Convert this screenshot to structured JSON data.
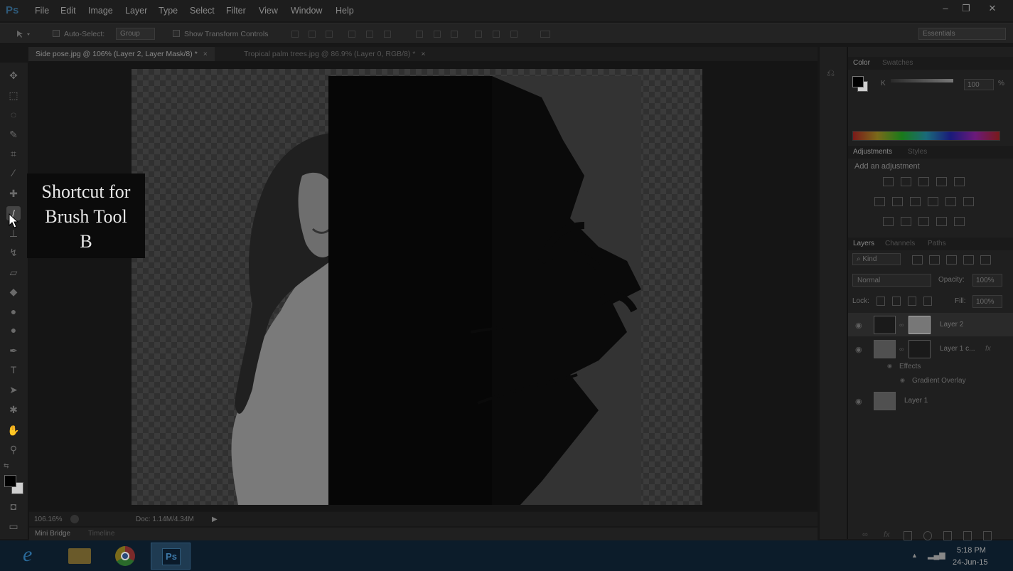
{
  "app": {
    "logo": "Ps",
    "menu": [
      "File",
      "Edit",
      "Image",
      "Layer",
      "Type",
      "Select",
      "Filter",
      "View",
      "Window",
      "Help"
    ],
    "window_controls": [
      "–",
      "❐",
      "✕"
    ]
  },
  "options_bar": {
    "auto_select_label": "Auto-Select:",
    "auto_select_value": "Group",
    "transform_label": "Show Transform Controls",
    "workspace": "Essentials"
  },
  "tabs": [
    {
      "label": "Side pose.jpg @ 106% (Layer 2, Layer Mask/8) *",
      "active": true
    },
    {
      "label": "Tropical palm trees.jpg @ 86.9% (Layer 0, RGB/8) *",
      "active": false
    }
  ],
  "tooltip": {
    "line1": "Shortcut for",
    "line2": "Brush Tool",
    "line3": "B"
  },
  "status": {
    "zoom": "106.16%",
    "doc": "Doc: 1.14M/4.34M"
  },
  "bottom_tabs": [
    "Mini Bridge",
    "Timeline"
  ],
  "color_panel": {
    "tabs": [
      "Color",
      "Swatches"
    ],
    "channel": "K",
    "value": "100",
    "unit": "%"
  },
  "adjustments_panel": {
    "tabs": [
      "Adjustments",
      "Styles"
    ],
    "title": "Add an adjustment"
  },
  "layers_panel": {
    "tabs": [
      "Layers",
      "Channels",
      "Paths"
    ],
    "filter": "Kind",
    "blend_mode": "Normal",
    "opacity_label": "Opacity:",
    "opacity": "100%",
    "lock_label": "Lock:",
    "fill_label": "Fill:",
    "fill": "100%",
    "layers": [
      "Layer 2",
      "Layer 1 c...",
      "Layer 1"
    ],
    "effects_label": "Effects",
    "effect": "Gradient Overlay",
    "fx": "fx"
  },
  "taskbar": {
    "time": "5:18 PM",
    "date": "24-Jun-15",
    "ps_label": "Ps"
  }
}
